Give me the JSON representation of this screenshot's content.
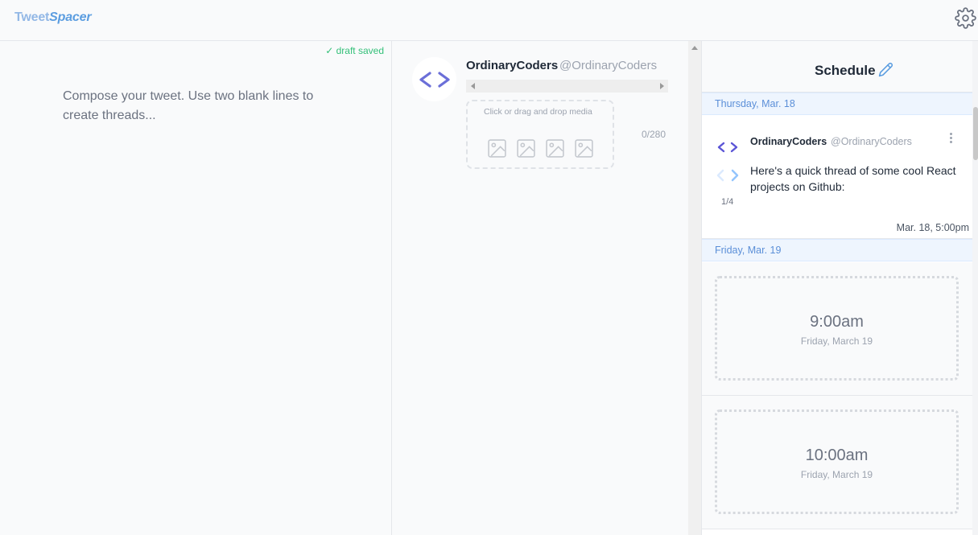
{
  "header": {
    "logo_part1": "Tweet",
    "logo_part2": "Spacer",
    "settings_icon": "gear-icon"
  },
  "compose": {
    "draft_status": "✓ draft saved",
    "placeholder": "Compose your tweet. Use two blank lines to create threads..."
  },
  "preview": {
    "avatar_icon": "code-brackets-icon",
    "name": "OrdinaryCoders",
    "handle": "@OrdinaryCoders",
    "media_label": "Click or drag and drop media",
    "media_icons": [
      "image-icon",
      "image-icon",
      "image-icon",
      "image-icon"
    ],
    "char_count": "0/280"
  },
  "schedule": {
    "title": "Schedule",
    "edit_icon": "pencil-icon",
    "days": [
      {
        "label": "Thursday, Mar. 18"
      },
      {
        "label": "Friday, Mar. 19"
      }
    ],
    "tweet": {
      "name": "OrdinaryCoders",
      "handle": "@OrdinaryCoders",
      "text": "Here's a quick thread of some cool React projects on Github:",
      "page": "1/4",
      "time": "Mar. 18, 5:00pm"
    },
    "slots": [
      {
        "time": "9:00am",
        "date": "Friday, March 19"
      },
      {
        "time": "10:00am",
        "date": "Friday, March 19"
      }
    ]
  },
  "colors": {
    "accent": "#5b9de0",
    "avatar_purple": "#6b6fd8",
    "draft_green": "#34c079"
  }
}
